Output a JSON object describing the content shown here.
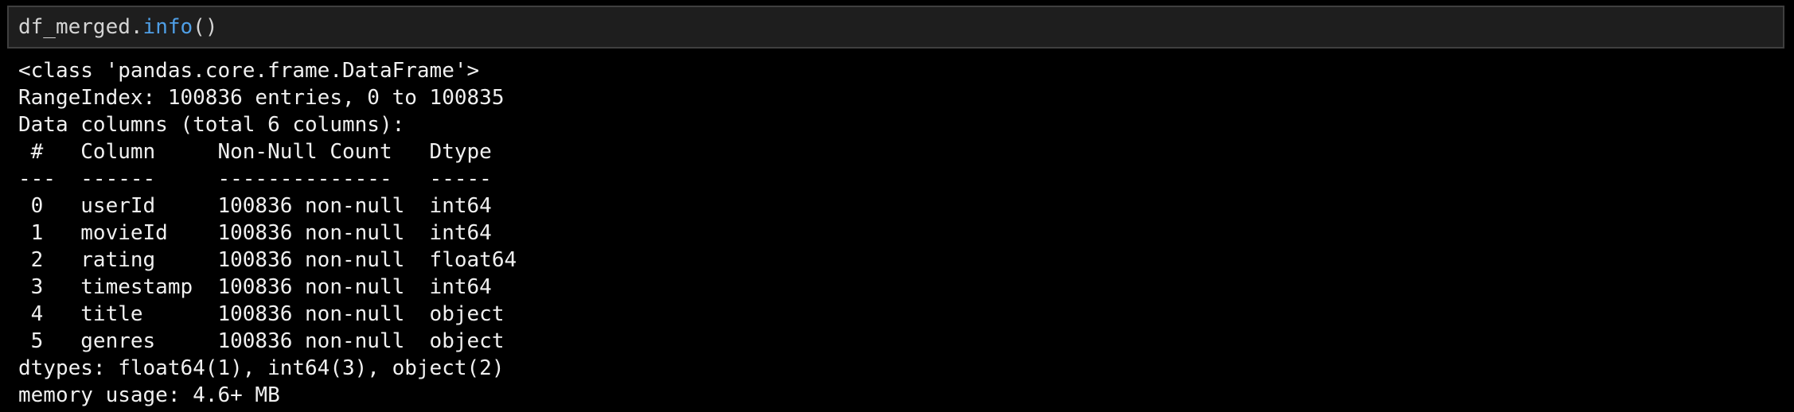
{
  "input": {
    "object": "df_merged",
    "dot": ".",
    "method": "info",
    "call": "()"
  },
  "output": {
    "lines": [
      "<class 'pandas.core.frame.DataFrame'>",
      "RangeIndex: 100836 entries, 0 to 100835",
      "Data columns (total 6 columns):",
      " #   Column     Non-Null Count   Dtype  ",
      "---  ------     --------------   -----  ",
      " 0   userId     100836 non-null  int64  ",
      " 1   movieId    100836 non-null  int64  ",
      " 2   rating     100836 non-null  float64",
      " 3   timestamp  100836 non-null  int64  ",
      " 4   title      100836 non-null  object ",
      " 5   genres     100836 non-null  object ",
      "dtypes: float64(1), int64(3), object(2)",
      "memory usage: 4.6+ MB"
    ]
  },
  "colors": {
    "background": "#000000",
    "input_background": "#1e1e1e",
    "method": "#4f9fe6",
    "text": "#f0f0f0"
  }
}
